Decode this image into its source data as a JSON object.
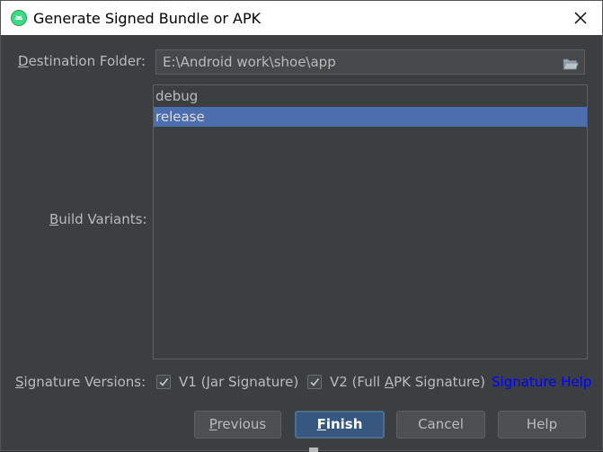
{
  "window": {
    "title": "Generate Signed Bundle or APK",
    "app_icon": "android-studio-icon",
    "close_icon": "close-icon"
  },
  "destination": {
    "label_mnemonic": "D",
    "label_rest": "estination Folder:",
    "value": "E:\\Android work\\shoe\\app",
    "browse_icon": "folder-icon"
  },
  "build_variants": {
    "label_mnemonic": "B",
    "label_rest": "uild Variants:",
    "items": [
      {
        "label": "debug",
        "selected": false
      },
      {
        "label": "release",
        "selected": true
      }
    ]
  },
  "signature": {
    "label_mnemonic": "S",
    "label_rest": "ignature Versions:",
    "v1": {
      "pre": "V1 (",
      "mnemonic": "J",
      "post": "ar Signature)",
      "checked": true
    },
    "v2": {
      "pre": "V2 (Full ",
      "mnemonic": "A",
      "post": "PK Signature)",
      "checked": true
    },
    "help_link": "Signature Help"
  },
  "buttons": {
    "previous": {
      "mnemonic": "P",
      "rest": "revious"
    },
    "finish": {
      "mnemonic": "F",
      "rest": "inish"
    },
    "cancel": "Cancel",
    "help": "Help"
  },
  "colors": {
    "background": "#3c3f41",
    "selection": "#4b6eaf",
    "default_button": "#365880",
    "link": "#0000ff"
  }
}
